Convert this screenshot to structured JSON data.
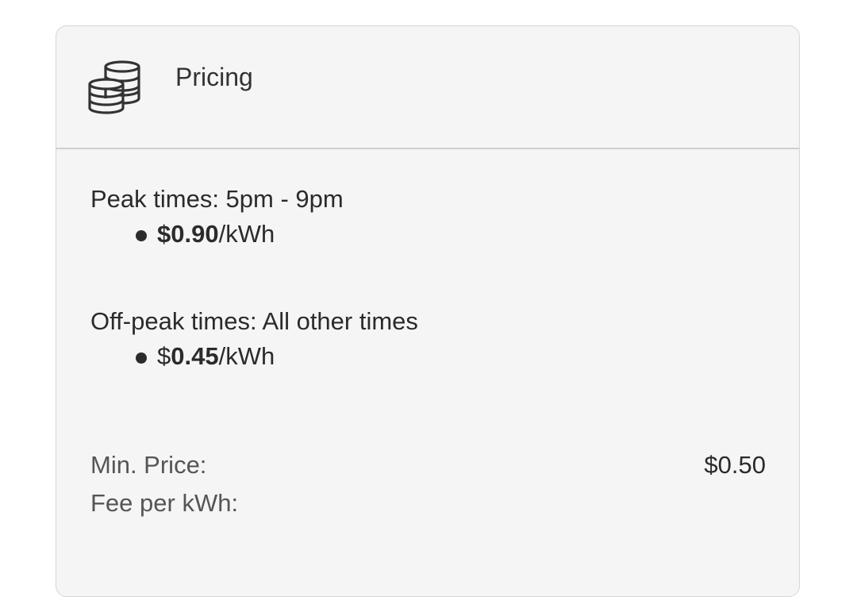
{
  "header": {
    "icon": "coins-icon",
    "title": "Pricing"
  },
  "peak": {
    "label": "Peak times: 5pm - 9pm",
    "price_prefix": "$0.90",
    "price_suffix": "/kWh"
  },
  "offpeak": {
    "label": "Off-peak times: All other times",
    "price_currency": "$",
    "price_amount": "0.45",
    "price_suffix": "/kWh"
  },
  "summary": {
    "min_price_label": "Min. Price:",
    "min_price_value": "$0.50",
    "fee_label": "Fee per kWh:",
    "fee_value": ""
  }
}
